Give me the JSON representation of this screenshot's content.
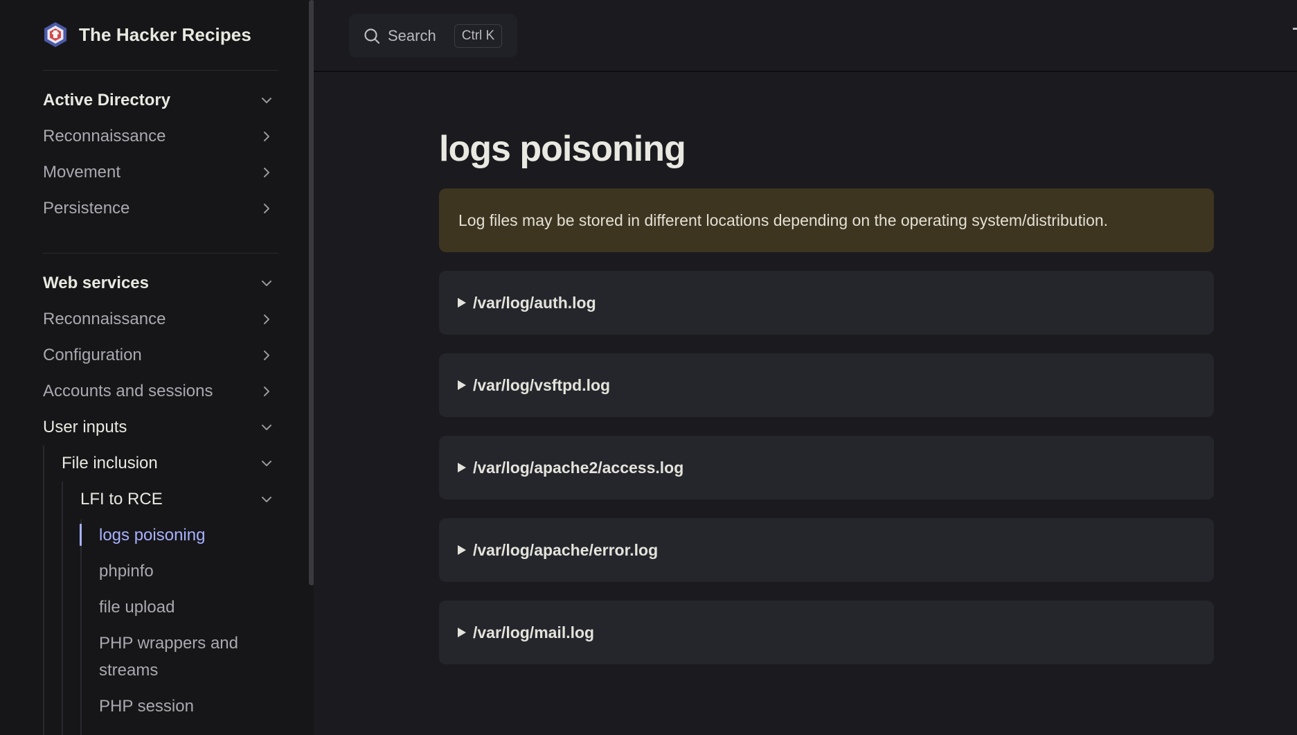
{
  "brand": {
    "title": "The Hacker Recipes"
  },
  "search": {
    "label": "Search",
    "shortcut": "Ctrl K"
  },
  "sidebar": {
    "sections": [
      {
        "title": "Active Directory",
        "items": [
          "Reconnaissance",
          "Movement",
          "Persistence"
        ]
      },
      {
        "title": "Web services",
        "items": [
          "Reconnaissance",
          "Configuration",
          "Accounts and sessions",
          "User inputs"
        ]
      }
    ],
    "file_inclusion": "File inclusion",
    "lfi_to_rce": "LFI to RCE",
    "leaves": {
      "logs_poisoning": "logs poisoning",
      "phpinfo": "phpinfo",
      "file_upload": "file upload",
      "php_wrappers_line1": "PHP wrappers and",
      "php_wrappers_line2": "streams",
      "php_session": "PHP session"
    }
  },
  "main": {
    "title": "logs poisoning",
    "callout": "Log files may be stored in different locations depending on the operating system/distribution.",
    "log_files": [
      "/var/log/auth.log",
      "/var/log/vsftpd.log",
      "/var/log/apache2/access.log",
      "/var/log/apache/error.log",
      "/var/log/mail.log"
    ]
  },
  "colors": {
    "accent": "#a8b1ff",
    "callout_bg": "#3e3520",
    "card_bg": "#25262b"
  }
}
